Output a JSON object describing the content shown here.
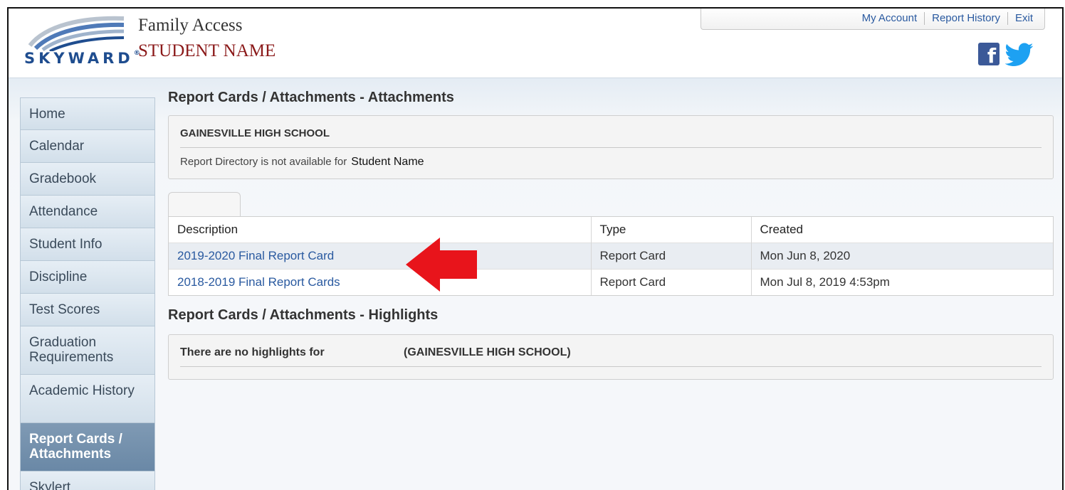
{
  "header": {
    "app_title": "Family Access",
    "student_name": "STUDENT NAME",
    "logo_text": "SKYWARD",
    "logo_mark": "®"
  },
  "topnav": {
    "items": [
      "My Account",
      "Report History",
      "Exit"
    ]
  },
  "social": {
    "facebook_glyph": "f",
    "icons": [
      "facebook-icon",
      "twitter-icon"
    ],
    "facebook_color": "#3b5998",
    "twitter_color": "#1da1f2"
  },
  "sidebar": {
    "items": [
      {
        "label": "Home"
      },
      {
        "label": "Calendar"
      },
      {
        "label": "Gradebook"
      },
      {
        "label": "Attendance"
      },
      {
        "label": "Student Info"
      },
      {
        "label": "Discipline"
      },
      {
        "label": "Test Scores"
      },
      {
        "label": "Graduation Requirements"
      },
      {
        "label": "Academic History"
      },
      {
        "label": "Report Cards / Attachments",
        "active": true
      },
      {
        "label": "Skylert"
      }
    ]
  },
  "attachments": {
    "title": "Report Cards / Attachments - Attachments",
    "school": "GAINESVILLE HIGH SCHOOL",
    "not_available_text": "Report Directory is not available for",
    "not_available_name": "Student Name",
    "columns": [
      "Description",
      "Type",
      "Created"
    ],
    "rows": [
      {
        "description": "2019-2020 Final Report Card",
        "type": "Report Card",
        "created": "Mon Jun 8, 2020"
      },
      {
        "description": "2018-2019 Final Report Cards",
        "type": "Report Card",
        "created": "Mon Jul 8, 2019 4:53pm"
      }
    ]
  },
  "highlights": {
    "title": "Report Cards / Attachments - Highlights",
    "text": "There are no highlights for",
    "school": "(GAINESVILLE HIGH SCHOOL)"
  },
  "annotation": {
    "arrow_color": "#e8141b"
  }
}
